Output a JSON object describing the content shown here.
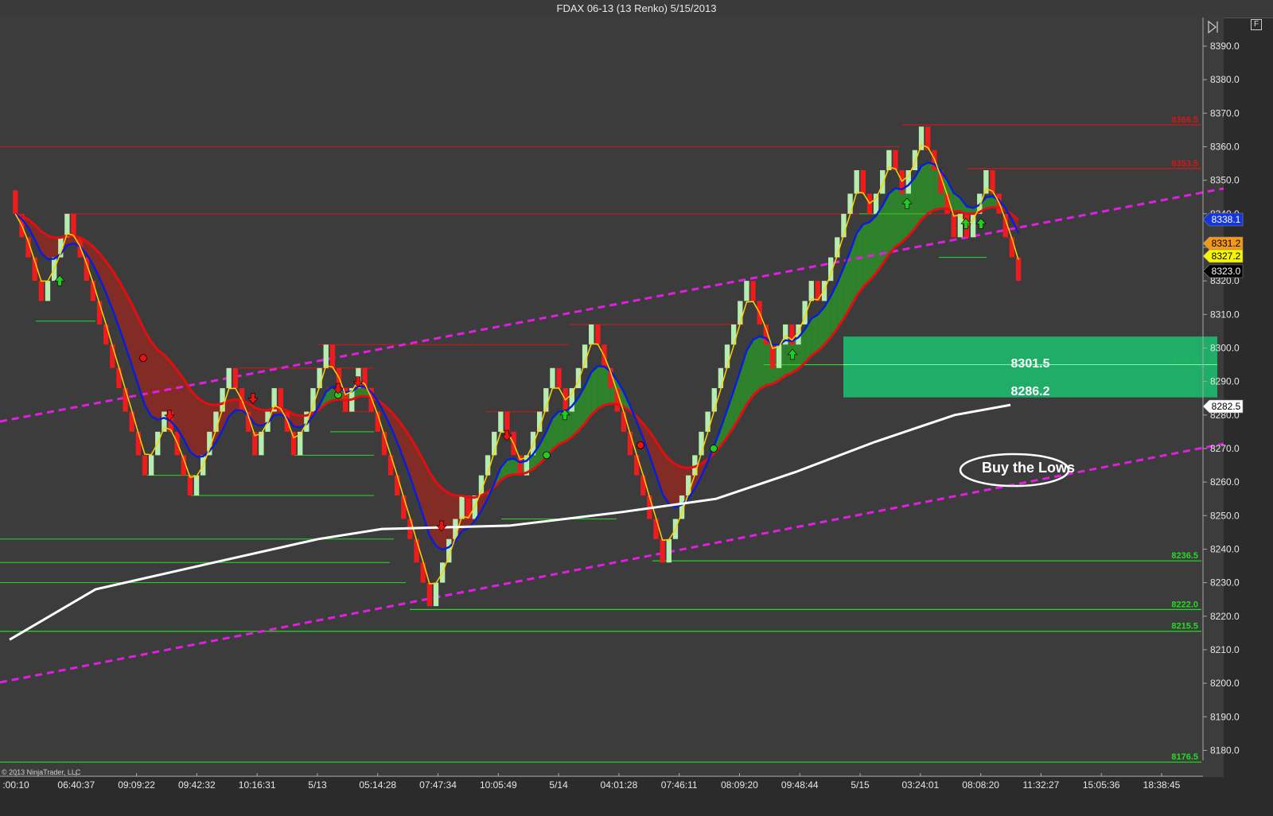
{
  "window": {
    "title": "FDAX 06-13 (13 Renko)  5/15/2013",
    "float_button": "F"
  },
  "copyright": "© 2013 NinjaTrader, LLC",
  "colors": {
    "background": "#3c3c3c",
    "up_brick": "#b5ecb0",
    "down_brick": "#ee1c1c",
    "fast_ma": "#ffd200",
    "slow_ma": "#0a1ed8",
    "ema_red": "#e01010",
    "sma_white": "#ffffff",
    "channel": "#e21ee2",
    "resistance": "#d01818",
    "support": "#22dd22",
    "zone": "#1db36a"
  },
  "chart_data": {
    "type": "renko",
    "instrument": "FDAX 06-13",
    "brick_size": 13,
    "ylim": [
      8168,
      8395
    ],
    "y_ticks": [
      8180.0,
      8190.0,
      8200.0,
      8210.0,
      8220.0,
      8230.0,
      8240.0,
      8250.0,
      8260.0,
      8270.0,
      8280.0,
      8290.0,
      8300.0,
      8310.0,
      8320.0,
      8330.0,
      8340.0,
      8350.0,
      8360.0,
      8370.0,
      8380.0,
      8390.0
    ],
    "x_labels": [
      ":00:10",
      "06:40:37",
      "09:09:22",
      "09:42:32",
      "10:16:31",
      "5/13",
      "05:14:28",
      "07:47:34",
      "10:05:49",
      "5/14",
      "04:01:28",
      "07:46:11",
      "08:09:20",
      "09:48:44",
      "5/15",
      "03:24:01",
      "08:08:20",
      "11:32:27",
      "15:05:36",
      "18:38:45"
    ],
    "price_markers": [
      {
        "value": "8338.1",
        "color": "#1535e0",
        "text_color": "#ffffff"
      },
      {
        "value": "8331.2",
        "color": "#f29a18",
        "text_color": "#000000"
      },
      {
        "value": "8327.2",
        "color": "#f6f600",
        "text_color": "#000000"
      },
      {
        "value": "8323.0",
        "color": "#000000",
        "text_color": "#ffffff"
      },
      {
        "value": "8282.5",
        "color": "#ffffff",
        "text_color": "#000000"
      }
    ],
    "levels": [
      {
        "value": 8366.5,
        "label": "8366.5",
        "kind": "resistance"
      },
      {
        "value": 8353.5,
        "label": "8353.5",
        "kind": "resistance"
      },
      {
        "value": 8295.0,
        "label": "8295.0",
        "kind": "support"
      },
      {
        "value": 8236.5,
        "label": "8236.5",
        "kind": "support"
      },
      {
        "value": 8222.0,
        "label": "8222.0",
        "kind": "support"
      },
      {
        "value": 8215.5,
        "label": "8215.5",
        "kind": "support"
      },
      {
        "value": 8176.5,
        "label": "8176.5",
        "kind": "support"
      }
    ],
    "zone": {
      "top": 8301.5,
      "bottom": 8286.2,
      "top_label": "8301.5",
      "bottom_label": "8286.2"
    },
    "annotation": "Buy the Lows",
    "close_series": [
      8347,
      8340,
      8333,
      8327,
      8320,
      8314,
      8320,
      8327,
      8333,
      8340,
      8333,
      8327,
      8320,
      8314,
      8307,
      8301,
      8294,
      8288,
      8281,
      8275,
      8268,
      8262,
      8268,
      8275,
      8281,
      8275,
      8268,
      8262,
      8256,
      8262,
      8268,
      8275,
      8281,
      8288,
      8294,
      8288,
      8281,
      8275,
      8268,
      8275,
      8281,
      8288,
      8281,
      8275,
      8268,
      8275,
      8281,
      8288,
      8294,
      8301,
      8294,
      8288,
      8281,
      8288,
      8294,
      8288,
      8281,
      8275,
      8268,
      8262,
      8256,
      8249,
      8243,
      8236,
      8230,
      8223,
      8230,
      8236,
      8243,
      8249,
      8256,
      8249,
      8256,
      8262,
      8268,
      8275,
      8281,
      8275,
      8268,
      8262,
      8268,
      8275,
      8281,
      8288,
      8294,
      8288,
      8281,
      8288,
      8294,
      8301,
      8307,
      8301,
      8294,
      8288,
      8281,
      8275,
      8268,
      8262,
      8256,
      8249,
      8243,
      8236,
      8243,
      8249,
      8256,
      8262,
      8268,
      8275,
      8281,
      8288,
      8294,
      8301,
      8307,
      8314,
      8320,
      8314,
      8307,
      8301,
      8294,
      8301,
      8307,
      8301,
      8307,
      8314,
      8320,
      8314,
      8320,
      8327,
      8333,
      8340,
      8346,
      8353,
      8346,
      8340,
      8346,
      8353,
      8359,
      8353,
      8346,
      8353,
      8359,
      8366,
      8359,
      8353,
      8346,
      8340,
      8333,
      8340,
      8333,
      8340,
      8346,
      8353,
      8346,
      8340,
      8333,
      8327,
      8320
    ]
  }
}
